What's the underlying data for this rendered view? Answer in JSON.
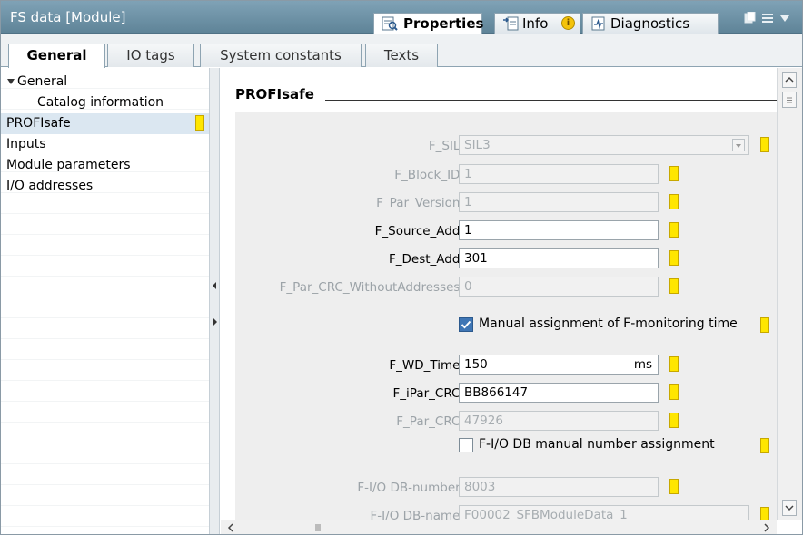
{
  "window": {
    "title": "FS data [Module]",
    "tabs": [
      {
        "label": "Properties",
        "icon": "properties-icon",
        "active": true
      },
      {
        "label": "Info",
        "icon": "info-icon",
        "active": false
      },
      {
        "label": "Diagnostics",
        "icon": "diagnostics-icon",
        "active": false
      }
    ],
    "info_badge": "i"
  },
  "subtabs": [
    {
      "label": "General",
      "active": true
    },
    {
      "label": "IO tags",
      "active": false
    },
    {
      "label": "System constants",
      "active": false
    },
    {
      "label": "Texts",
      "active": false
    }
  ],
  "tree": {
    "items": [
      {
        "label": "General",
        "expanded": true,
        "level": 0
      },
      {
        "label": "Catalog information",
        "level": 1
      },
      {
        "label": "PROFIsafe",
        "level": 0,
        "selected": true
      },
      {
        "label": "Inputs",
        "level": 0
      },
      {
        "label": "Module parameters",
        "level": 0
      },
      {
        "label": "I/O addresses",
        "level": 0
      }
    ]
  },
  "section": {
    "title": "PROFIsafe"
  },
  "fields": [
    {
      "label": "F_SIL:",
      "value": "SIL3",
      "enabled": false,
      "type": "dropdown"
    },
    {
      "label": "F_Block_ID:",
      "value": "1",
      "enabled": false
    },
    {
      "label": "F_Par_Version:",
      "value": "1",
      "enabled": false
    },
    {
      "label": "F_Source_Add:",
      "value": "1",
      "enabled": true
    },
    {
      "label": "F_Dest_Add:",
      "value": "301",
      "enabled": true
    },
    {
      "label": "F_Par_CRC_WithoutAddresses:",
      "value": "0",
      "enabled": false
    }
  ],
  "manual_monitoring": {
    "label": "Manual assignment of F-monitoring time",
    "checked": true
  },
  "fields2": [
    {
      "label": "F_WD_Time:",
      "value": "150",
      "unit": "ms",
      "enabled": true
    },
    {
      "label": "F_iPar_CRC:",
      "value": "BB866147",
      "enabled": true
    },
    {
      "label": "F_Par_CRC:",
      "value": "47926",
      "enabled": false
    }
  ],
  "manual_db": {
    "label": "F-I/O DB manual number assignment",
    "checked": false
  },
  "fields3": [
    {
      "label": "F-I/O DB-number:",
      "value": "8003",
      "enabled": false
    },
    {
      "label": "F-I/O DB-name:",
      "value": "F00002_SFBModuleData_1",
      "enabled": false
    }
  ],
  "colors": {
    "accent": "#3f76b5",
    "marker": "#ffe600",
    "titlebar": "#6f93a7"
  }
}
